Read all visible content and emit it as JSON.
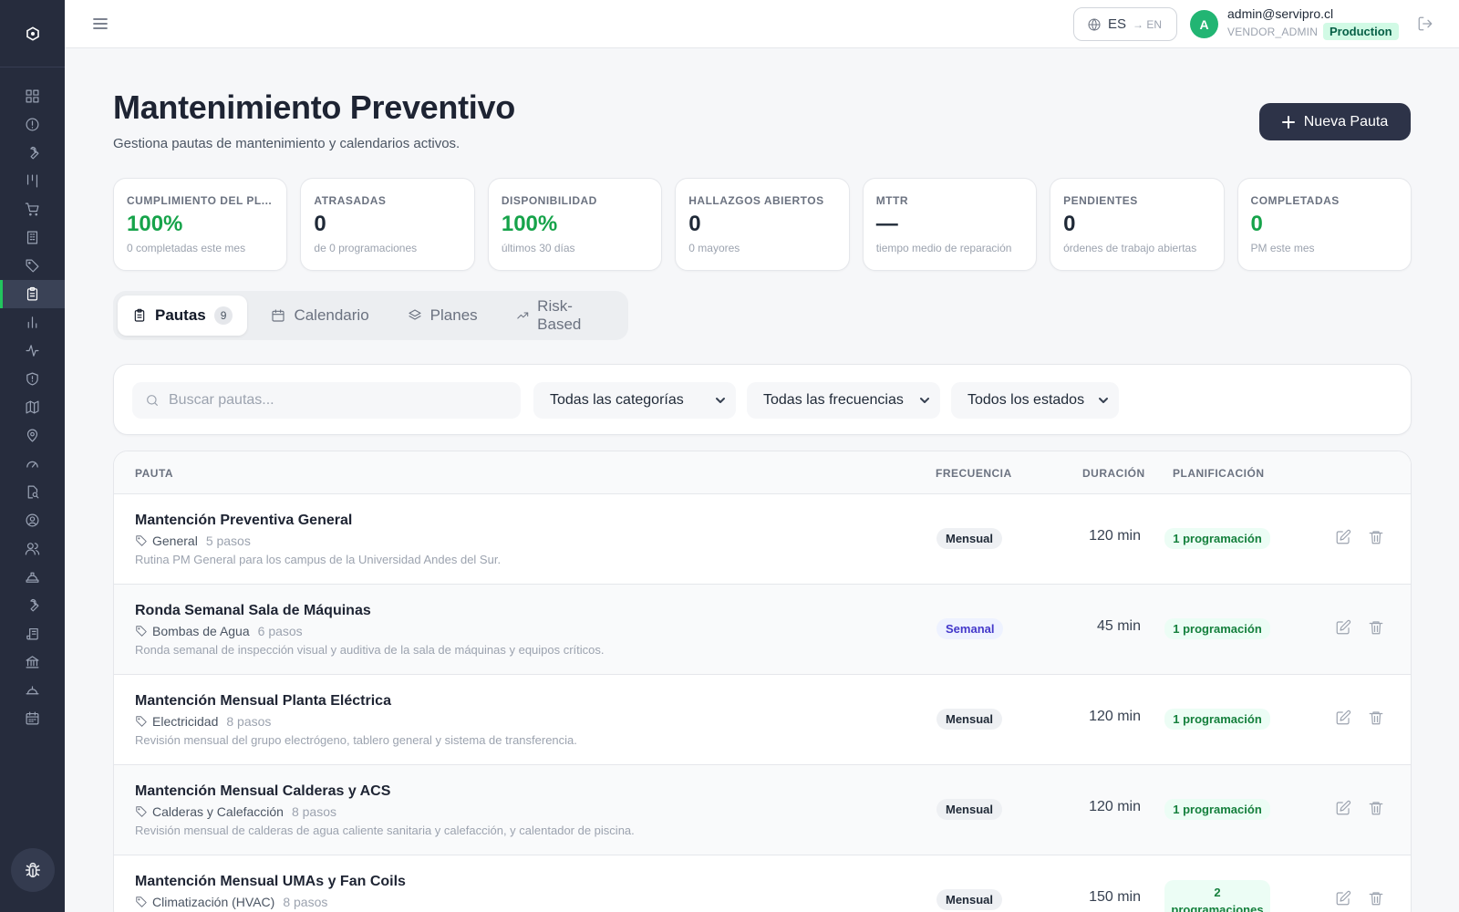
{
  "sidebar": {
    "logo_icon": "hexagon-logo-icon",
    "items": [
      {
        "icon": "dashboard-icon"
      },
      {
        "icon": "alert-icon"
      },
      {
        "icon": "wrench-icon"
      },
      {
        "icon": "kanban-icon"
      },
      {
        "icon": "cart-icon"
      },
      {
        "icon": "building-icon"
      },
      {
        "icon": "tag-icon"
      },
      {
        "icon": "clipboard-icon",
        "active": true
      },
      {
        "icon": "bar-chart-icon"
      },
      {
        "icon": "activity-icon"
      },
      {
        "icon": "shield-icon"
      },
      {
        "icon": "map-icon"
      },
      {
        "icon": "map-pin-icon"
      },
      {
        "icon": "gauge-icon"
      },
      {
        "icon": "file-search-icon"
      },
      {
        "icon": "user-circle-icon"
      },
      {
        "icon": "users-icon"
      },
      {
        "icon": "hard-hat-icon"
      },
      {
        "icon": "tool-icon"
      },
      {
        "icon": "scroll-icon"
      },
      {
        "icon": "bank-icon"
      },
      {
        "icon": "helmet-icon"
      },
      {
        "icon": "calendar-icon"
      }
    ],
    "bug_icon": "bug-icon"
  },
  "topbar": {
    "lang_current": "ES",
    "lang_other": "→ EN",
    "avatar_initial": "A",
    "user_email": "admin@servipro.cl",
    "user_role": "VENDOR_ADMIN",
    "env": "Production"
  },
  "header": {
    "title": "Mantenimiento Preventivo",
    "subtitle": "Gestiona pautas de mantenimiento y calendarios activos.",
    "new_button": "Nueva Pauta"
  },
  "kpis": [
    {
      "label": "CUMPLIMIENTO DEL PL...",
      "value": "100%",
      "sub": "0 completadas este mes",
      "color": "#16a34a"
    },
    {
      "label": "ATRASADAS",
      "value": "0",
      "sub": "de 0 programaciones",
      "color": "#1f2937"
    },
    {
      "label": "DISPONIBILIDAD",
      "value": "100%",
      "sub": "últimos 30 días",
      "color": "#16a34a"
    },
    {
      "label": "HALLAZGOS ABIERTOS",
      "value": "0",
      "sub": "0 mayores",
      "color": "#1f2937"
    },
    {
      "label": "MTTR",
      "value": "—",
      "sub": "tiempo medio de reparación",
      "color": "#1f2937"
    },
    {
      "label": "PENDIENTES",
      "value": "0",
      "sub": "órdenes de trabajo abiertas",
      "color": "#1f2937"
    },
    {
      "label": "COMPLETADAS",
      "value": "0",
      "sub": "PM este mes",
      "color": "#16a34a"
    }
  ],
  "tabs": [
    {
      "label": "Pautas",
      "count": "9",
      "icon": "clipboard-list-icon",
      "active": true
    },
    {
      "label": "Calendario",
      "icon": "calendar-icon"
    },
    {
      "label": "Planes",
      "icon": "layers-icon"
    },
    {
      "label": "Risk-Based",
      "icon": "trending-up-icon"
    }
  ],
  "filters": {
    "search_placeholder": "Buscar pautas...",
    "category": "Todas las categorías",
    "frequency": "Todas las frecuencias",
    "status": "Todos los estados"
  },
  "table": {
    "columns": {
      "pauta": "PAUTA",
      "frecuencia": "FRECUENCIA",
      "duracion": "DURACIÓN",
      "planificacion": "PLANIFICACIÓN"
    },
    "rows": [
      {
        "name": "Mantención Preventiva General",
        "category": "General",
        "steps": "5 pasos",
        "description": "Rutina PM General para los campus de la Universidad Andes del Sur.",
        "frequency": "Mensual",
        "duration": "120 min",
        "plan": "1 programación"
      },
      {
        "name": "Ronda Semanal Sala de Máquinas",
        "category": "Bombas de Agua",
        "steps": "6 pasos",
        "description": "Ronda semanal de inspección visual y auditiva de la sala de máquinas y equipos críticos.",
        "frequency": "Semanal",
        "duration": "45 min",
        "plan": "1 programación",
        "weekly": true
      },
      {
        "name": "Mantención Mensual Planta Eléctrica",
        "category": "Electricidad",
        "steps": "8 pasos",
        "description": "Revisión mensual del grupo electrógeno, tablero general y sistema de transferencia.",
        "frequency": "Mensual",
        "duration": "120 min",
        "plan": "1 programación"
      },
      {
        "name": "Mantención Mensual Calderas y ACS",
        "category": "Calderas y Calefacción",
        "steps": "8 pasos",
        "description": "Revisión mensual de calderas de agua caliente sanitaria y calefacción, y calentador de piscina.",
        "frequency": "Mensual",
        "duration": "120 min",
        "plan": "1 programación"
      },
      {
        "name": "Mantención Mensual UMAs y Fan Coils",
        "category": "Climatización (HVAC)",
        "steps": "8 pasos",
        "description": "",
        "frequency": "Mensual",
        "duration": "150 min",
        "plan": "2 programaciones"
      }
    ]
  }
}
